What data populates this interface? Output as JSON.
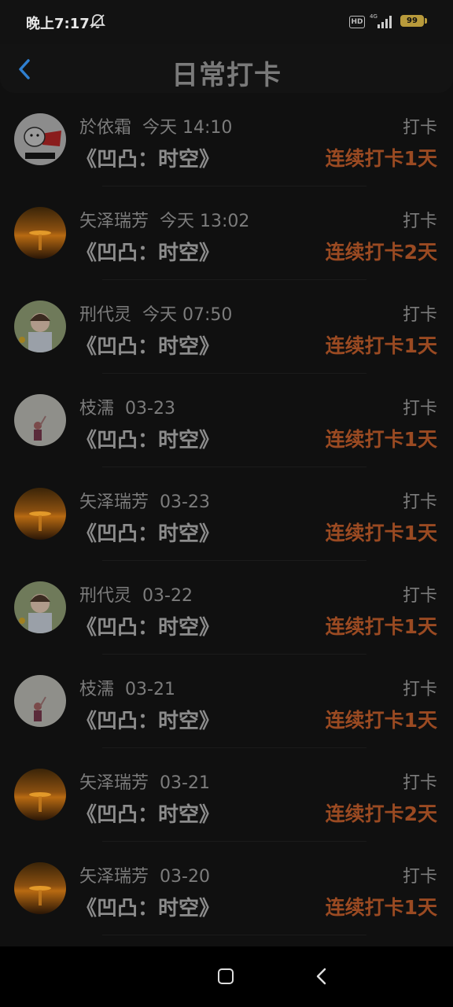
{
  "status": {
    "time": "晚上7:17",
    "hd": "HD",
    "network": "4G",
    "battery": "99"
  },
  "header": {
    "title": "日常打卡"
  },
  "colors": {
    "streak": "#9a4a22",
    "back_arrow": "#2f7fd0"
  },
  "records": [
    {
      "name": "於依霜",
      "time": "今天 14:10",
      "book": "《凹凸：时空》",
      "action": "打卡",
      "streak": "连续打卡1天",
      "avatar": "cartoon"
    },
    {
      "name": "矢泽瑞芳",
      "time": "今天 13:02",
      "book": "《凹凸：时空》",
      "action": "打卡",
      "streak": "连续打卡2天",
      "avatar": "sunset"
    },
    {
      "name": "刑代灵",
      "time": "今天 07:50",
      "book": "《凹凸：时空》",
      "action": "打卡",
      "streak": "连续打卡1天",
      "avatar": "girl"
    },
    {
      "name": "枝濡",
      "time": "03-23",
      "book": "《凹凸：时空》",
      "action": "打卡",
      "streak": "连续打卡1天",
      "avatar": "child"
    },
    {
      "name": "矢泽瑞芳",
      "time": "03-23",
      "book": "《凹凸：时空》",
      "action": "打卡",
      "streak": "连续打卡1天",
      "avatar": "sunset"
    },
    {
      "name": "刑代灵",
      "time": "03-22",
      "book": "《凹凸：时空》",
      "action": "打卡",
      "streak": "连续打卡1天",
      "avatar": "girl"
    },
    {
      "name": "枝濡",
      "time": "03-21",
      "book": "《凹凸：时空》",
      "action": "打卡",
      "streak": "连续打卡1天",
      "avatar": "child"
    },
    {
      "name": "矢泽瑞芳",
      "time": "03-21",
      "book": "《凹凸：时空》",
      "action": "打卡",
      "streak": "连续打卡2天",
      "avatar": "sunset"
    },
    {
      "name": "矢泽瑞芳",
      "time": "03-20",
      "book": "《凹凸：时空》",
      "action": "打卡",
      "streak": "连续打卡1天",
      "avatar": "sunset"
    }
  ]
}
